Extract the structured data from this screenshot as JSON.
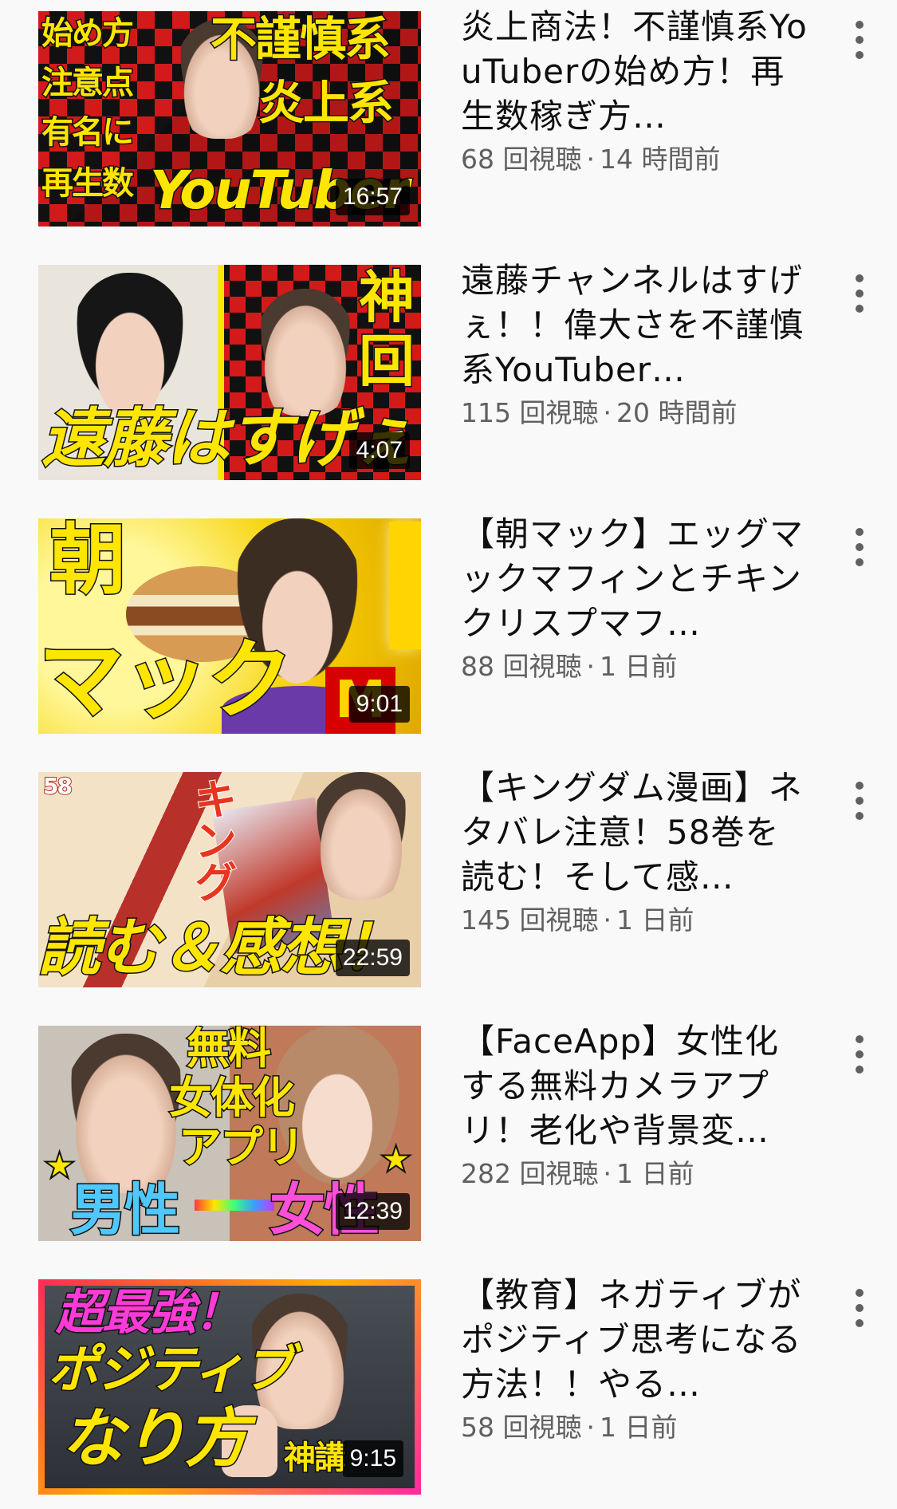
{
  "videos": [
    {
      "title": "炎上商法！不謹慎系YouTuberの始め方！再生数稼ぎ方…",
      "views": "68 回視聴",
      "age": "14 時間前",
      "duration": "16:57",
      "thumb_text": [
        "始め方",
        "注意点",
        "有名に",
        "再生数",
        "不謹慎系",
        "炎上系",
        "YouTuber"
      ],
      "colors": {
        "bg": "#c0171c",
        "accent": "#ffe600"
      }
    },
    {
      "title": "遠藤チャンネルはすげぇ！！偉大さを不謹慎系YouTuber…",
      "views": "115 回視聴",
      "age": "20 時間前",
      "duration": "4:07",
      "thumb_text": [
        "遠藤はすげぇ",
        "神",
        "回"
      ],
      "colors": {
        "bg": "#2d2d2d",
        "accent": "#ffe600"
      }
    },
    {
      "title": "【朝マック】エッグマックマフィンとチキンクリスプマフ…",
      "views": "88 回視聴",
      "age": "1 日前",
      "duration": "9:01",
      "thumb_text": [
        "朝",
        "マック"
      ],
      "colors": {
        "bg": "#f6d000",
        "accent": "#ffe600"
      }
    },
    {
      "title": "【キングダム漫画】ネタバレ注意！58巻を読む！そして感…",
      "views": "145 回視聴",
      "age": "1 日前",
      "duration": "22:59",
      "thumb_text": [
        "58",
        "キング",
        "読む＆感想！"
      ],
      "colors": {
        "bg": "#f0d7b8",
        "accent": "#ffe600"
      }
    },
    {
      "title": "【FaceApp】女性化する無料カメラアプリ！老化や背景変…",
      "views": "282 回視聴",
      "age": "1 日前",
      "duration": "12:39",
      "thumb_text": [
        "無料",
        "女体化",
        "アプリ",
        "男性",
        "女性"
      ],
      "colors": {
        "bg": "#7a5a48",
        "accent": "#ffe600"
      }
    },
    {
      "title": "【教育】ネガティブがポジティブ思考になる方法！！やる…",
      "views": "58 回視聴",
      "age": "1 日前",
      "duration": "9:15",
      "thumb_text": [
        "超最強！",
        "ポジティブ",
        "なり方",
        "神講"
      ],
      "colors": {
        "bg": "#3b3f45",
        "accent": "#ffe600"
      }
    }
  ],
  "separator": "·",
  "more_icon": "vertical-ellipsis-icon"
}
